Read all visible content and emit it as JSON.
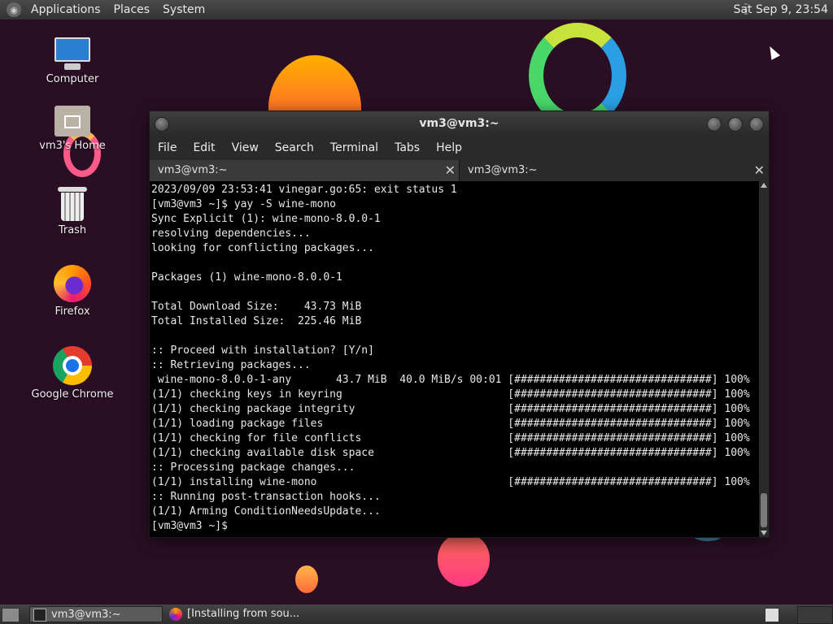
{
  "top_panel": {
    "menus": [
      "Applications",
      "Places",
      "System"
    ],
    "clock": "Sat Sep  9, 23:54"
  },
  "desktop_icons": [
    {
      "label": "Computer",
      "icon": "computer-icon"
    },
    {
      "label": "vm3's Home",
      "icon": "home-folder-icon"
    },
    {
      "label": "Trash",
      "icon": "trash-icon"
    },
    {
      "label": "Firefox",
      "icon": "firefox-icon"
    },
    {
      "label": "Google Chrome",
      "icon": "chrome-icon"
    }
  ],
  "terminal": {
    "title": "vm3@vm3:~",
    "menu": [
      "File",
      "Edit",
      "View",
      "Search",
      "Terminal",
      "Tabs",
      "Help"
    ],
    "tabs": [
      {
        "label": "vm3@vm3:~",
        "active": true
      },
      {
        "label": "vm3@vm3:~",
        "active": false
      }
    ],
    "lines": [
      "2023/09/09 23:53:41 vinegar.go:65: exit status 1",
      "[vm3@vm3 ~]$ yay -S wine-mono",
      "Sync Explicit (1): wine-mono-8.0.0-1",
      "resolving dependencies...",
      "looking for conflicting packages...",
      "",
      "Packages (1) wine-mono-8.0.0-1",
      "",
      "Total Download Size:    43.73 MiB",
      "Total Installed Size:  225.46 MiB",
      "",
      ":: Proceed with installation? [Y/n]",
      ":: Retrieving packages...",
      " wine-mono-8.0.0-1-any       43.7 MiB  40.0 MiB/s 00:01 [###############################] 100%",
      "(1/1) checking keys in keyring                          [###############################] 100%",
      "(1/1) checking package integrity                        [###############################] 100%",
      "(1/1) loading package files                             [###############################] 100%",
      "(1/1) checking for file conflicts                       [###############################] 100%",
      "(1/1) checking available disk space                     [###############################] 100%",
      ":: Processing package changes...",
      "(1/1) installing wine-mono                              [###############################] 100%",
      ":: Running post-transaction hooks...",
      "(1/1) Arming ConditionNeedsUpdate...",
      "[vm3@vm3 ~]$ "
    ]
  },
  "bottom_panel": {
    "tasks": [
      {
        "label": "vm3@vm3:~",
        "icon": "terminal-icon"
      },
      {
        "label": "[Installing from sou...",
        "icon": "firefox-icon"
      }
    ]
  }
}
